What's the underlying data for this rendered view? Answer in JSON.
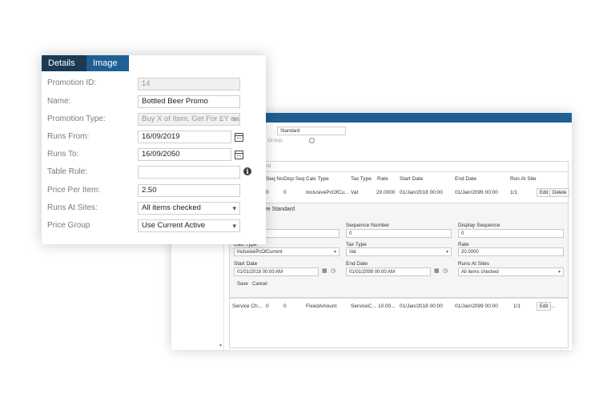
{
  "back_window": {
    "top_field_value": "Standard",
    "group_label_fragment": "Group:",
    "section_label_fragment": "ecord",
    "table": {
      "headers": [
        "Seq No",
        "Disp Seq",
        "Calc Type",
        "Tax Type",
        "Rate",
        "Start Date",
        "End Date",
        "Run At Site"
      ],
      "row1": {
        "seq_fragment": "0",
        "seq_no": "0",
        "calc_type": "InclusivePcOfCu...",
        "tax_type": "Vat",
        "rate": "20.0000",
        "start_date": "01/Jan/2018 00:00",
        "end_date": "01/Jan/2099 00:00",
        "run_at_site": "1/1",
        "edit": "Edit",
        "delete": "Delete"
      },
      "row2": {
        "name": "Service Ch...",
        "seq_no": "0",
        "disp_seq": "0",
        "calc_type": "FixedAmount",
        "tax_type": "ServiceC...",
        "rate": "10.00...",
        "start_date": "01/Jan/2018 00:00",
        "end_date": "01/Jan/2099 00:00",
        "run_at_site": "1/1",
        "edit": "Edit",
        "more": "..."
      }
    },
    "editor": {
      "title_fragment": "sure Standard",
      "sequence_number_label": "Sequence Number",
      "sequence_number_value": "0",
      "display_sequence_label": "Display Sequence",
      "display_sequence_value": "0",
      "calc_type_label": "Calc Type",
      "calc_type_value": "InclusivePcOfCurrent",
      "tax_type_label": "Tax Type",
      "tax_type_value": "Vat",
      "rate_label": "Rate",
      "rate_value": "20.0000",
      "start_date_label": "Start Date",
      "start_date_value": "01/01/2018 00:00 AM",
      "end_date_label": "End Date",
      "end_date_value": "01/01/2099 00:00 AM",
      "runs_at_sites_label": "Runs At Sites",
      "runs_at_sites_value": "All items checked",
      "save": "Save",
      "cancel": "Cancel"
    }
  },
  "dialog": {
    "tabs": [
      {
        "label": "Details"
      },
      {
        "label": "Image"
      }
    ],
    "fields": {
      "promotion_id": {
        "label": "Promotion ID:",
        "value": "14"
      },
      "name": {
        "label": "Name:",
        "value": "Bottled Beer Promo"
      },
      "promotion_type": {
        "label": "Promotion Type:",
        "value": "Buy X of Item, Get For £Y ea"
      },
      "runs_from": {
        "label": "Runs From:",
        "value": "16/09/2019"
      },
      "runs_to": {
        "label": "Runs To:",
        "value": "16/09/2050"
      },
      "table_rule": {
        "label": "Table Rule:",
        "value": ""
      },
      "price_per_item": {
        "label": "Price Per Item:",
        "value": "2.50"
      },
      "runs_at_sites": {
        "label": "Runs At Sites:",
        "value": "All items checked"
      },
      "price_group": {
        "label": "Price Group",
        "value": "Use Current Active"
      }
    }
  }
}
